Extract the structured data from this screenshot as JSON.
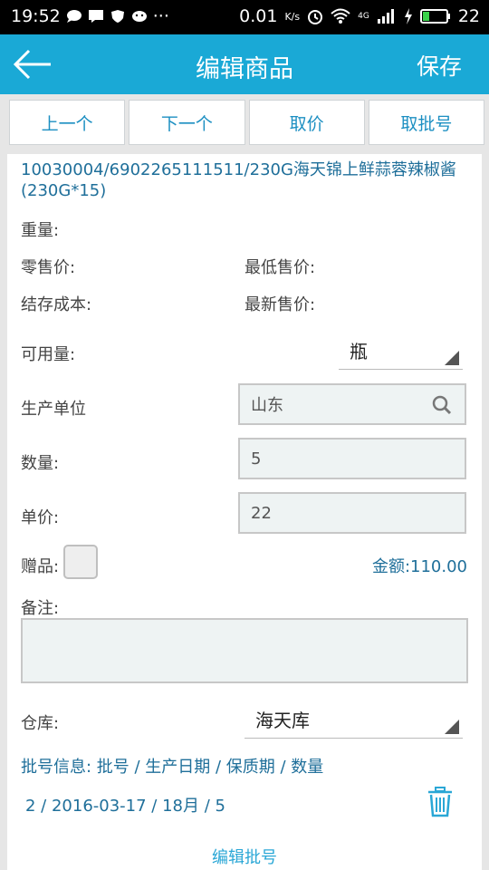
{
  "status_bar": {
    "time": "19:52",
    "left_extra": "···",
    "speed": "0.01",
    "speed_unit": "K/s",
    "network": "4G",
    "battery": "22"
  },
  "app_bar": {
    "title": "编辑商品",
    "save_label": "保存"
  },
  "tabs": [
    "上一个",
    "下一个",
    "取价",
    "取批号"
  ],
  "product": {
    "name": "10030004/6902265111511/230G海天锦上鲜蒜蓉辣椒酱(230G*15)"
  },
  "fields": {
    "weight_label": "重量:",
    "retail_price_label": "零售价:",
    "min_price_label": "最低售价:",
    "stock_cost_label": "结存成本:",
    "latest_price_label": "最新售价:",
    "available_label": "可用量:",
    "unit_value": "瓶",
    "manufacturer_label": "生产单位",
    "manufacturer_value": "山东",
    "quantity_label": "数量:",
    "quantity_value": "5",
    "unit_price_label": "单价:",
    "unit_price_value": "22",
    "gift_label": "赠品:",
    "amount_text": "金额:110.00",
    "remark_label": "备注:",
    "warehouse_label": "仓库:",
    "warehouse_value": "海天库"
  },
  "batch": {
    "header": "批号信息: 批号 / 生产日期 / 保质期 / 数量",
    "row": "2 / 2016-03-17 / 18月 / 5",
    "edit_label": "编辑批号"
  },
  "colors": {
    "app_bar": "#1aa9d6",
    "accent_text": "#1f6f9a",
    "link": "#2aa7d6"
  }
}
